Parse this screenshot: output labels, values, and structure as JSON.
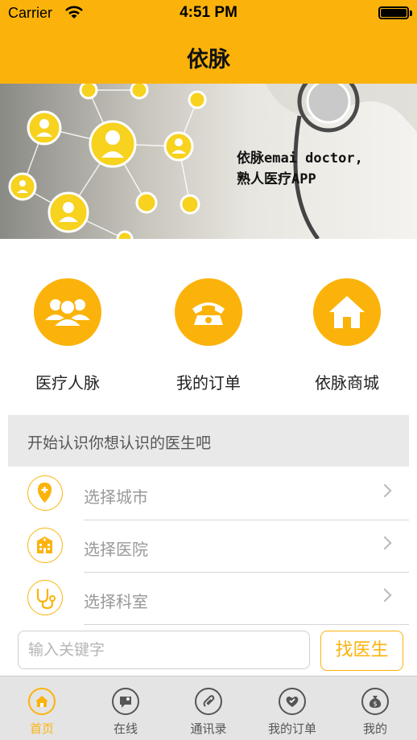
{
  "status": {
    "carrier": "Carrier",
    "time": "4:51 PM"
  },
  "nav": {
    "title": "依脉"
  },
  "banner": {
    "line1": "依脉emai doctor,",
    "line2": "熟人医疗APP"
  },
  "quick_entries": [
    {
      "label": "医疗人脉",
      "icon": "people-icon"
    },
    {
      "label": "我的订单",
      "icon": "phone-icon"
    },
    {
      "label": "依脉商城",
      "icon": "home-icon"
    }
  ],
  "section": {
    "title": "开始认识你想认识的医生吧"
  },
  "filters": [
    {
      "label": "选择城市",
      "icon": "location-pin-icon"
    },
    {
      "label": "选择医院",
      "icon": "hospital-icon"
    },
    {
      "label": "选择科室",
      "icon": "stethoscope-icon"
    }
  ],
  "search": {
    "placeholder": "输入关键字",
    "button": "找医生"
  },
  "tabs": [
    {
      "label": "首页",
      "icon": "home-tab-icon",
      "active": true
    },
    {
      "label": "在线",
      "icon": "chat-tab-icon",
      "active": false
    },
    {
      "label": "通讯录",
      "icon": "contacts-tab-icon",
      "active": false
    },
    {
      "label": "我的订单",
      "icon": "orders-tab-icon",
      "active": false
    },
    {
      "label": "我的",
      "icon": "profile-tab-icon",
      "active": false
    }
  ],
  "colors": {
    "accent": "#fbb30b",
    "tabbar": "#e4e4e4",
    "section_bg": "#e9e9e9"
  }
}
